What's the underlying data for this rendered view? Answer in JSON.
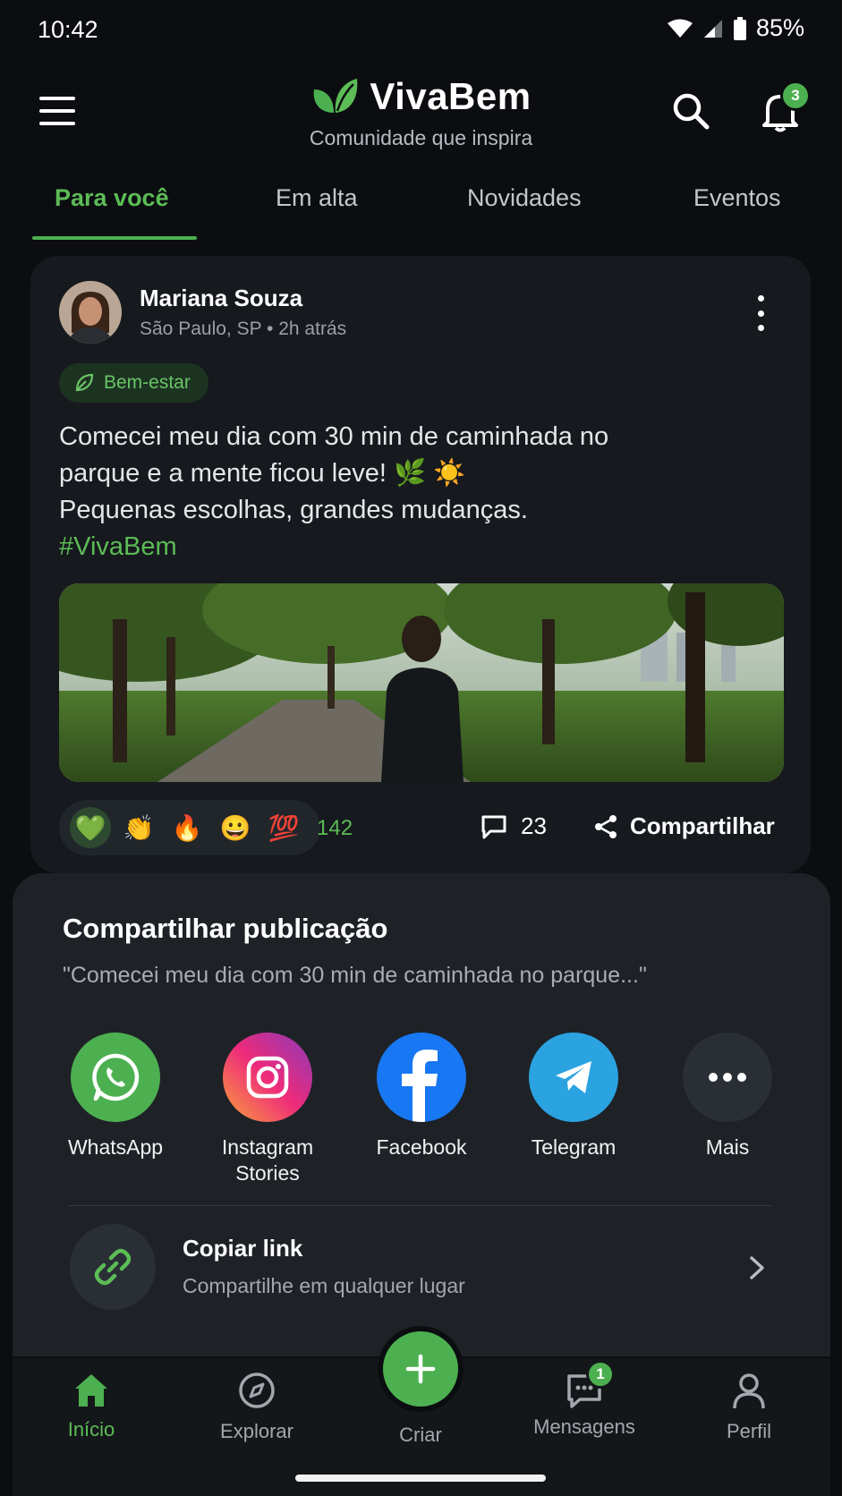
{
  "status_bar": {
    "time": "10:42",
    "battery": "85%"
  },
  "header": {
    "brand": "VivaBem",
    "tagline": "Comunidade que inspira",
    "notifications_count": "3"
  },
  "tabs": [
    {
      "label": "Para você",
      "active": true
    },
    {
      "label": "Em alta"
    },
    {
      "label": "Novidades"
    },
    {
      "label": "Eventos"
    }
  ],
  "post": {
    "author": "Mariana Souza",
    "meta": "São Paulo, SP • 2h atrás",
    "category": "Bem-estar",
    "text_lines": [
      "Comecei meu dia com 30 min de caminhada no",
      "parque e a mente ficou leve! 🌿 ☀️",
      "Pequenas escolhas, grandes mudanças."
    ],
    "hashtag": "#VivaBem",
    "reactions": [
      "💚",
      "👏",
      "🔥",
      "😀",
      "💯"
    ],
    "reaction_count": "142",
    "comment_count": "23",
    "share_label": "Compartilhar"
  },
  "share_sheet": {
    "title": "Compartilhar publicação",
    "quote": "\"Comecei meu dia com 30 min de caminhada no parque...\"",
    "apps": [
      {
        "label": "WhatsApp",
        "color": "#4cb050"
      },
      {
        "label": "Instagram\nStories",
        "line1": "Instagram",
        "line2": "Stories"
      },
      {
        "label": "Facebook",
        "color": "#1877f2"
      },
      {
        "label": "Telegram",
        "color": "#2aa3e0"
      },
      {
        "label": "Mais",
        "color": "#2a2f35"
      }
    ],
    "copy_link": {
      "title": "Copiar link",
      "subtitle": "Compartilhe em qualquer lugar"
    }
  },
  "bottom_nav": {
    "items": [
      {
        "label": "Início",
        "active": true
      },
      {
        "label": "Explorar"
      },
      {
        "label": "Criar"
      },
      {
        "label": "Mensagens",
        "badge": "1"
      },
      {
        "label": "Perfil"
      }
    ]
  },
  "colors": {
    "accent": "#4cb050",
    "background": "#0b0d10",
    "card": "#16191d",
    "sheet": "#1e2227"
  }
}
